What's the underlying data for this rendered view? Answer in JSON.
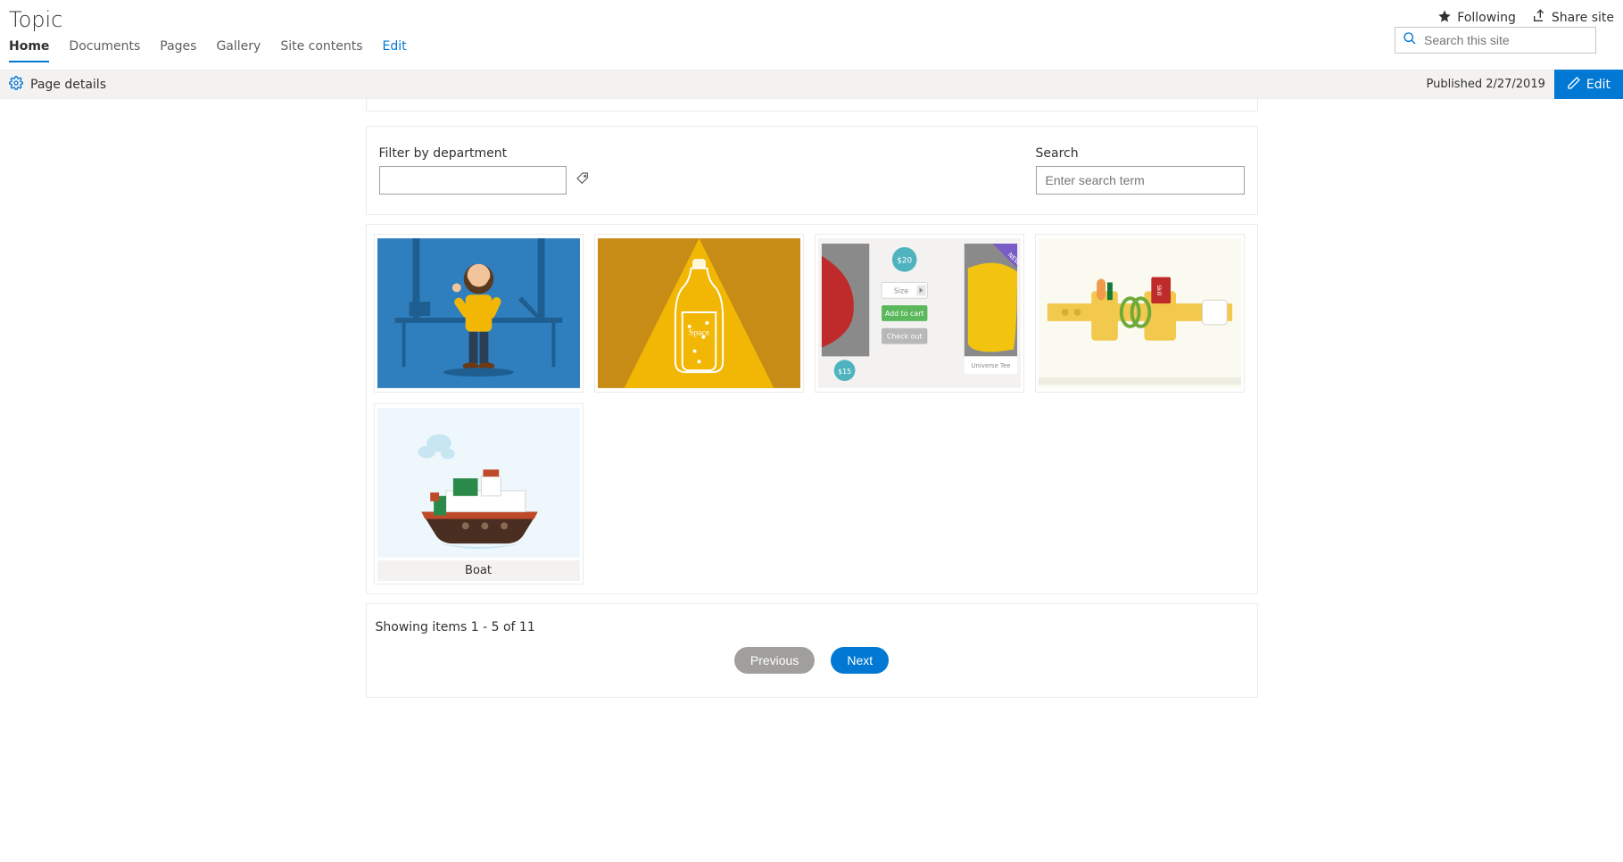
{
  "site": {
    "title": "Topic"
  },
  "nav": {
    "items": [
      {
        "label": "Home",
        "active": true
      },
      {
        "label": "Documents"
      },
      {
        "label": "Pages"
      },
      {
        "label": "Gallery"
      },
      {
        "label": "Site contents"
      },
      {
        "label": "Edit",
        "edit": true
      }
    ]
  },
  "header_actions": {
    "following": "Following",
    "share": "Share site",
    "search_placeholder": "Search this site"
  },
  "command_bar": {
    "page_details": "Page details",
    "published": "Published 2/27/2019",
    "edit": "Edit"
  },
  "filter": {
    "dept_label": "Filter by department",
    "search_label": "Search",
    "search_placeholder": "Enter search term"
  },
  "gallery": {
    "items": [
      {
        "caption": ""
      },
      {
        "caption": ""
      },
      {
        "caption": ""
      },
      {
        "caption": ""
      },
      {
        "caption": "Boat"
      }
    ]
  },
  "pager": {
    "status": "Showing items 1 - 5 of 11",
    "prev": "Previous",
    "next": "Next"
  }
}
